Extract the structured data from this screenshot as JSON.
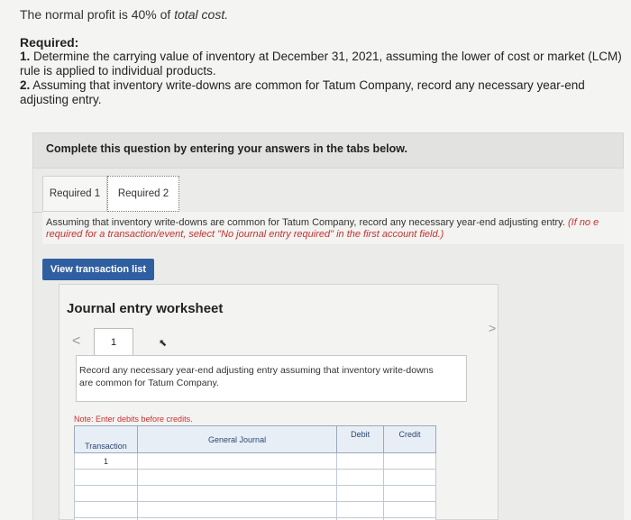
{
  "intro": {
    "normal_profit_prefix": "The normal profit is 40% of ",
    "normal_profit_italic": "total cost.",
    "required_heading": "Required:",
    "req1_num": "1.",
    "req1_text": " Determine the carrying value of inventory at December 31, 2021, assuming the lower of cost or market (LCM) rule is applied to individual products.",
    "req2_num": "2.",
    "req2_text": " Assuming that inventory write-downs are common for Tatum Company, record any necessary year-end adjusting entry."
  },
  "banner": "Complete this question by entering your answers in the tabs below.",
  "tabs": [
    {
      "label": "Required 1"
    },
    {
      "label": "Required 2"
    }
  ],
  "instructions": {
    "main": "Assuming that inventory write-downs are common for Tatum Company, record any necessary year-end adjusting entry. ",
    "red": "(If no e required for a transaction/event, select \"No journal entry required\" in the first account field.)"
  },
  "view_button": "View transaction list",
  "worksheet": {
    "title": "Journal entry worksheet",
    "page": "1",
    "prev_icon": "<",
    "next_icon": ">",
    "description": "Record any necessary year-end adjusting entry assuming that inventory write-downs are common for Tatum Company.",
    "note": "Note: Enter debits before credits.",
    "columns": {
      "transaction": "Transaction",
      "general_journal": "General Journal",
      "debit": "Debit",
      "credit": "Credit"
    },
    "rows": [
      {
        "transaction": "1"
      },
      {
        "transaction": ""
      },
      {
        "transaction": ""
      },
      {
        "transaction": ""
      },
      {
        "transaction": ""
      }
    ]
  }
}
